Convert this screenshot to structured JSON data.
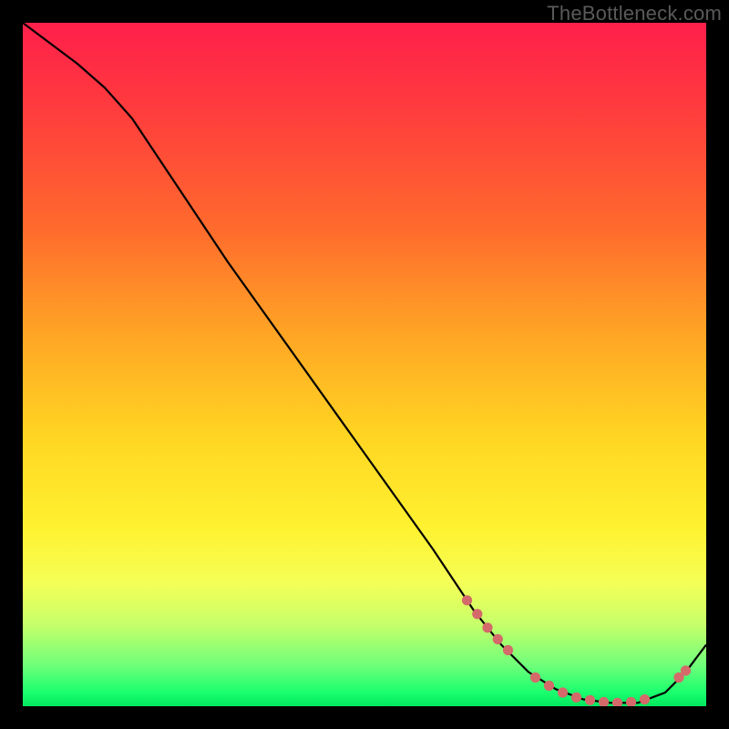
{
  "watermark": "TheBottleneck.com",
  "chart_data": {
    "type": "line",
    "title": "",
    "xlabel": "",
    "ylabel": "",
    "xlim": [
      0,
      100
    ],
    "ylim": [
      0,
      100
    ],
    "grid": false,
    "legend": false,
    "series": [
      {
        "name": "curve",
        "color": "#000000",
        "x": [
          0,
          4,
          8,
          12,
          16,
          22,
          30,
          40,
          50,
          60,
          66,
          70,
          74,
          78,
          82,
          86,
          90,
          94,
          97,
          100
        ],
        "y": [
          100,
          97,
          94,
          90.5,
          86,
          77,
          65,
          51,
          37,
          23,
          14,
          9,
          5,
          2.5,
          1,
          0.5,
          0.5,
          2,
          5,
          9
        ]
      }
    ],
    "highlight_points": {
      "color": "#d46a6a",
      "radius_frac": 0.0075,
      "points": [
        {
          "x": 65,
          "y": 15.5
        },
        {
          "x": 66.5,
          "y": 13.5
        },
        {
          "x": 68,
          "y": 11.5
        },
        {
          "x": 69.5,
          "y": 9.8
        },
        {
          "x": 71,
          "y": 8.2
        },
        {
          "x": 75,
          "y": 4.2
        },
        {
          "x": 77,
          "y": 3.0
        },
        {
          "x": 79,
          "y": 2.0
        },
        {
          "x": 81,
          "y": 1.3
        },
        {
          "x": 83,
          "y": 0.9
        },
        {
          "x": 85,
          "y": 0.6
        },
        {
          "x": 87,
          "y": 0.5
        },
        {
          "x": 89,
          "y": 0.6
        },
        {
          "x": 91,
          "y": 1.0
        },
        {
          "x": 96,
          "y": 4.2
        },
        {
          "x": 97,
          "y": 5.2
        }
      ]
    }
  }
}
